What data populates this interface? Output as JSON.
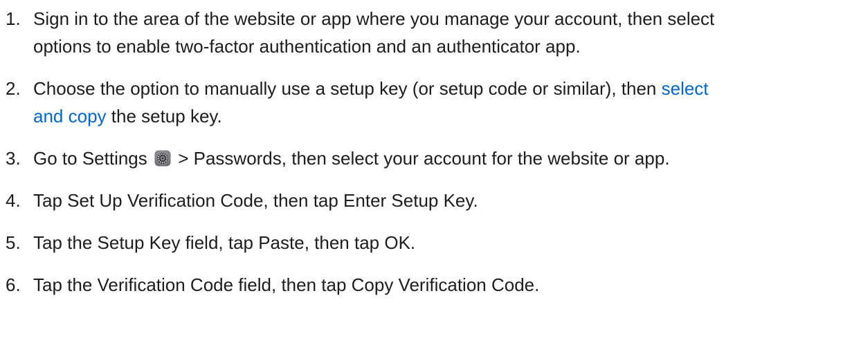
{
  "steps": [
    {
      "number": "1.",
      "line1": "Sign in to the area of the website or app where you manage your account, then select",
      "line2": "options to enable two-factor authentication and an authenticator app."
    },
    {
      "number": "2.",
      "line1_before": "Choose the option to manually use a setup key (or setup code or similar), then ",
      "line1_link": "select",
      "line2_link": "and copy",
      "line2_after": " the setup key."
    },
    {
      "number": "3.",
      "before_icon": "Go to Settings ",
      "icon": "settings-icon",
      "after_icon": " > Passwords, then select your account for the website or app."
    },
    {
      "number": "4.",
      "text": "Tap Set Up Verification Code, then tap Enter Setup Key."
    },
    {
      "number": "5.",
      "text": "Tap the Setup Key field, tap Paste, then tap OK."
    },
    {
      "number": "6.",
      "text": "Tap the Verification Code field, then tap Copy Verification Code."
    }
  ],
  "colors": {
    "text": "#1d1d1f",
    "link": "#0066cc",
    "background": "#ffffff"
  }
}
